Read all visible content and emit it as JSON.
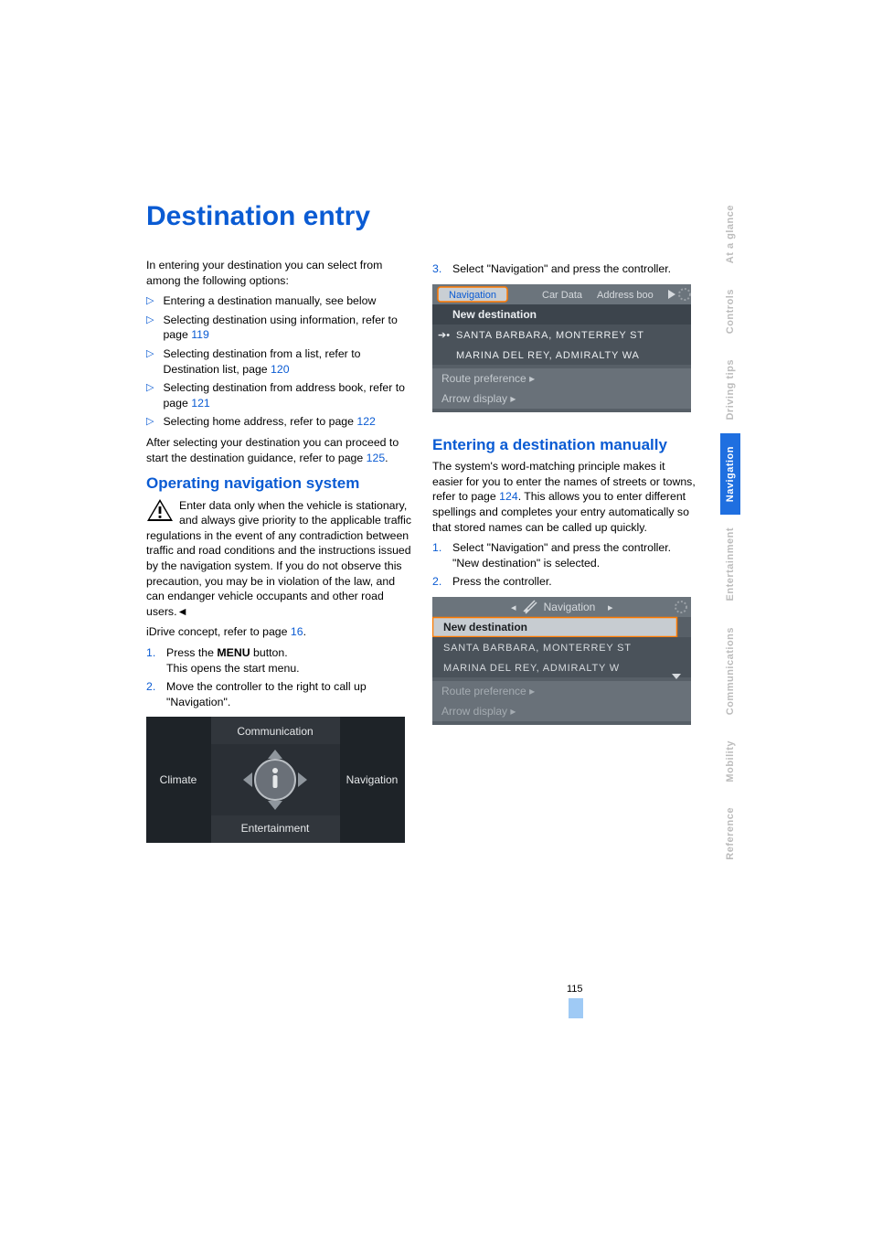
{
  "title": "Destination entry",
  "intro": "In entering your destination you can select from among the following options:",
  "bullets": [
    {
      "text": "Entering a destination manually, see below"
    },
    {
      "text": "Selecting destination using information, refer to page ",
      "link": "119"
    },
    {
      "text": "Selecting destination from a list, refer to Destination list, page ",
      "link": "120"
    },
    {
      "text": "Selecting destination from address book, refer to page ",
      "link": "121"
    },
    {
      "text": "Selecting home address, refer to page ",
      "link": "122"
    }
  ],
  "after_select_a": "After selecting your destination you can proceed to start the destination guidance, refer to page ",
  "after_select_link": "125",
  "after_select_b": ".",
  "heading_opnav": "Operating navigation system",
  "warn_text": "Enter data only when the vehicle is stationary, and always give priority to the applicable traffic regulations in the event of any contradiction between traffic and road conditions and the instructions issued by the navigation system. If you do not observe this precaution, you may be in violation of the law, and can endanger vehicle occupants and other road users.",
  "warn_end": "◄",
  "idrive_a": "iDrive concept, refer to page ",
  "idrive_link": "16",
  "idrive_b": ".",
  "left_steps": [
    {
      "n": "1.",
      "line1_a": "Press the ",
      "line1_bold": "MENU",
      "line1_b": " button.",
      "line2": "This opens the start menu."
    },
    {
      "n": "2.",
      "line1": "Move the controller to the right to call up \"Navigation\"."
    }
  ],
  "idrive_menu": {
    "top": "Communication",
    "left": "Climate",
    "right": "Navigation",
    "bottom": "Entertainment"
  },
  "right_step3": {
    "n": "3.",
    "text": "Select \"Navigation\" and press the controller."
  },
  "screen1": {
    "tabs": [
      "Navigation",
      "Car Data",
      "Address boo"
    ],
    "row1": "New destination",
    "row2": "SANTA BARBARA, MONTERREY ST",
    "row3": "MARINA DEL REY, ADMIRALTY WA",
    "row4": "Route preference",
    "row5": "Arrow display",
    "chev": "▸"
  },
  "heading_manual": "Entering a destination manually",
  "manual_para_a": "The system's word-matching principle makes it easier for you to enter the names of streets or towns, refer to page ",
  "manual_link": "124",
  "manual_para_b": ". This allows you to enter different spellings and completes your entry automatically so that stored names can be called up quickly.",
  "manual_steps": [
    {
      "n": "1.",
      "line1": "Select \"Navigation\" and press the controller.",
      "line2": "\"New destination\" is selected."
    },
    {
      "n": "2.",
      "line1": "Press the controller."
    }
  ],
  "screen2": {
    "header": "Navigation",
    "chev_l": "◂",
    "chev_r": "▸",
    "row1": "New destination",
    "row2": "SANTA BARBARA, MONTERREY ST",
    "row3": "MARINA DEL REY, ADMIRALTY W",
    "row4": "Route preference",
    "row5": "Arrow display"
  },
  "sidetabs": [
    {
      "label": "At a glance",
      "active": false
    },
    {
      "label": "Controls",
      "active": false
    },
    {
      "label": "Driving tips",
      "active": false
    },
    {
      "label": "Navigation",
      "active": true
    },
    {
      "label": "Entertainment",
      "active": false
    },
    {
      "label": "Communications",
      "active": false
    },
    {
      "label": "Mobility",
      "active": false
    },
    {
      "label": "Reference",
      "active": false
    }
  ],
  "page_number": "115"
}
